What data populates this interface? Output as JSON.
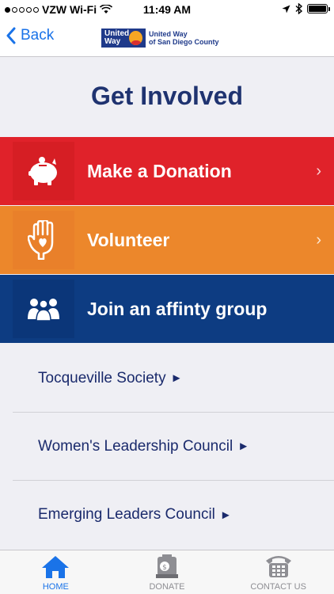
{
  "status_bar": {
    "carrier": "VZW Wi-Fi",
    "time": "11:49 AM"
  },
  "nav": {
    "back_label": "Back",
    "logo_box_line1": "United",
    "logo_box_line2": "Way",
    "logo_text_line1": "United Way",
    "logo_text_line2": "of San Diego County"
  },
  "page": {
    "title": "Get Involved"
  },
  "actions": [
    {
      "label": "Make a Donation",
      "icon": "piggy-bank-icon",
      "color": "#e0222a"
    },
    {
      "label": "Volunteer",
      "icon": "hand-heart-icon",
      "color": "#ec872b"
    },
    {
      "label": "Join an affinty group",
      "icon": "group-icon",
      "color": "#0d3c82"
    }
  ],
  "links": [
    {
      "label": "Tocqueville Society"
    },
    {
      "label": "Women's Leadership Council"
    },
    {
      "label": "Emerging Leaders Council"
    }
  ],
  "link_arrow": "►",
  "chevron": "›",
  "tabs": [
    {
      "label": "HOME",
      "icon": "home-icon",
      "active": true
    },
    {
      "label": "DONATE",
      "icon": "donate-icon",
      "active": false
    },
    {
      "label": "CONTACT US",
      "icon": "phone-icon",
      "active": false
    }
  ],
  "colors": {
    "accent": "#1a73e8",
    "title": "#1f3370"
  }
}
